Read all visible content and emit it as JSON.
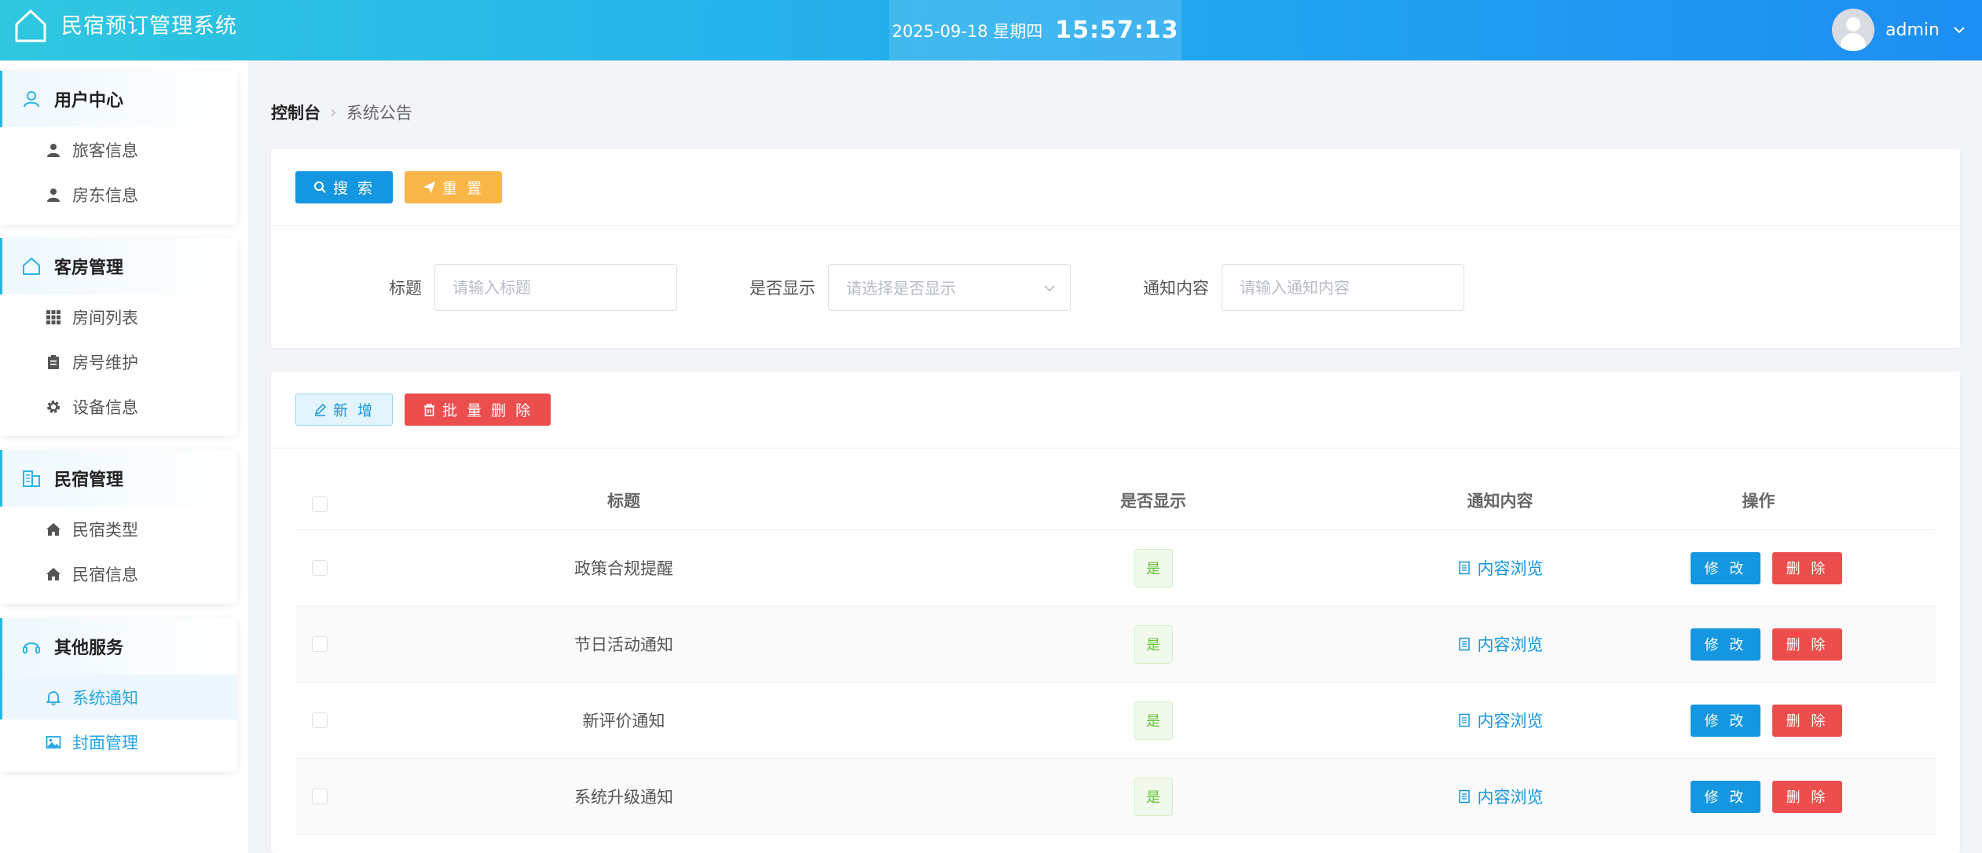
{
  "header": {
    "title": "民宿预订管理系统",
    "date": "2025-09-18 星期四",
    "time": "15:57:13",
    "username": "admin"
  },
  "sidebar": {
    "groups": [
      {
        "title": "用户中心",
        "icon": "user-icon",
        "items": [
          {
            "label": "旅客信息",
            "icon": "person-icon"
          },
          {
            "label": "房东信息",
            "icon": "person-icon"
          }
        ]
      },
      {
        "title": "客房管理",
        "icon": "home-outline-icon",
        "items": [
          {
            "label": "房间列表",
            "icon": "grid-icon"
          },
          {
            "label": "房号维护",
            "icon": "clipboard-icon"
          },
          {
            "label": "设备信息",
            "icon": "gear-icon"
          }
        ]
      },
      {
        "title": "民宿管理",
        "icon": "building-icon",
        "items": [
          {
            "label": "民宿类型",
            "icon": "home-icon"
          },
          {
            "label": "民宿信息",
            "icon": "home-icon"
          }
        ]
      },
      {
        "title": "其他服务",
        "icon": "headset-icon",
        "items": [
          {
            "label": "系统通知",
            "icon": "bell-icon",
            "active": true
          },
          {
            "label": "封面管理",
            "icon": "image-icon"
          }
        ]
      }
    ]
  },
  "breadcrumb": {
    "home": "控制台",
    "current": "系统公告"
  },
  "search_toolbar": {
    "search": "搜 索",
    "reset": "重 置"
  },
  "filters": {
    "title_label": "标题",
    "title_placeholder": "请输入标题",
    "show_label": "是否显示",
    "show_placeholder": "请选择是否显示",
    "content_label": "通知内容",
    "content_placeholder": "请输入通知内容"
  },
  "list_toolbar": {
    "add": "新 增",
    "batch_delete": "批 量 删 除"
  },
  "table": {
    "columns": [
      "标题",
      "是否显示",
      "通知内容",
      "操作"
    ],
    "rows": [
      {
        "title": "政策合规提醒",
        "show": "是",
        "content": "内容浏览"
      },
      {
        "title": "节日活动通知",
        "show": "是",
        "content": "内容浏览"
      },
      {
        "title": "新评价通知",
        "show": "是",
        "content": "内容浏览"
      },
      {
        "title": "系统升级通知",
        "show": "是",
        "content": "内容浏览"
      }
    ],
    "edit_label": "修 改",
    "delete_label": "删 除"
  },
  "colors": {
    "accent": "#1496e0",
    "danger": "#ec4e4e",
    "warning": "#f8b548",
    "success": "#67c23a"
  }
}
